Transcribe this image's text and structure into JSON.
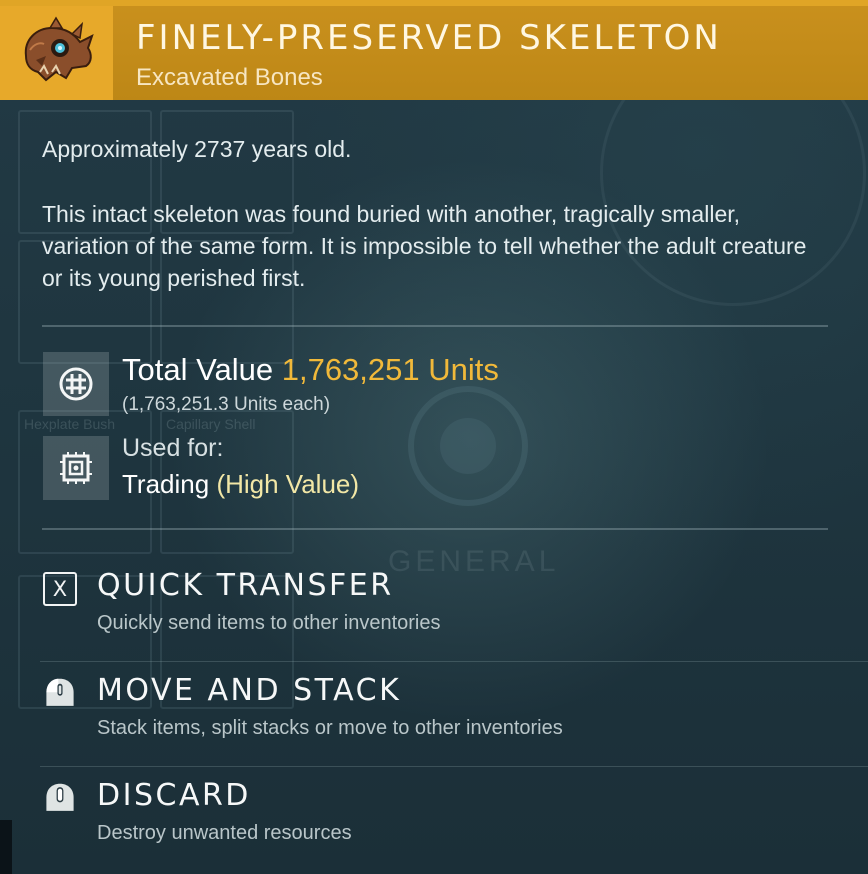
{
  "item": {
    "name": "FINELY-PRESERVED SKELETON",
    "category": "Excavated Bones",
    "icon": "skull-icon"
  },
  "age": {
    "prefix": "Approximately",
    "years": "2737",
    "suffix": "years old."
  },
  "description": "This intact skeleton was found buried with another, tragically smaller, variation of the same form. It is impossible to tell whether the adult creature or its young perished first.",
  "value": {
    "label": "Total Value",
    "amount": "1,763,251 Units",
    "each": "(1,763,251.3 Units each)",
    "icon": "units-icon"
  },
  "usage": {
    "label": "Used for:",
    "use": "Trading",
    "qualifier": "(High Value)",
    "icon": "trade-chip-icon"
  },
  "actions": [
    {
      "key": "X",
      "title": "QUICK TRANSFER",
      "description": "Quickly send items to other inventories",
      "icon": "x-key-icon"
    },
    {
      "title": "MOVE AND STACK",
      "description": "Stack items, split stacks or move to other inventories",
      "icon": "mouse-left-icon"
    },
    {
      "title": "DISCARD",
      "description": "Destroy unwanted resources",
      "icon": "mouse-middle-icon"
    }
  ],
  "background": {
    "labels": [
      "Hexplate Bush",
      "Capillary Shell",
      "GENERAL"
    ]
  },
  "colors": {
    "header": "#c38a18",
    "icon_box": "#e7a92a",
    "accent_gold": "#f1b93a",
    "high_value": "#f2e7a6",
    "panel": "#1f3640"
  }
}
